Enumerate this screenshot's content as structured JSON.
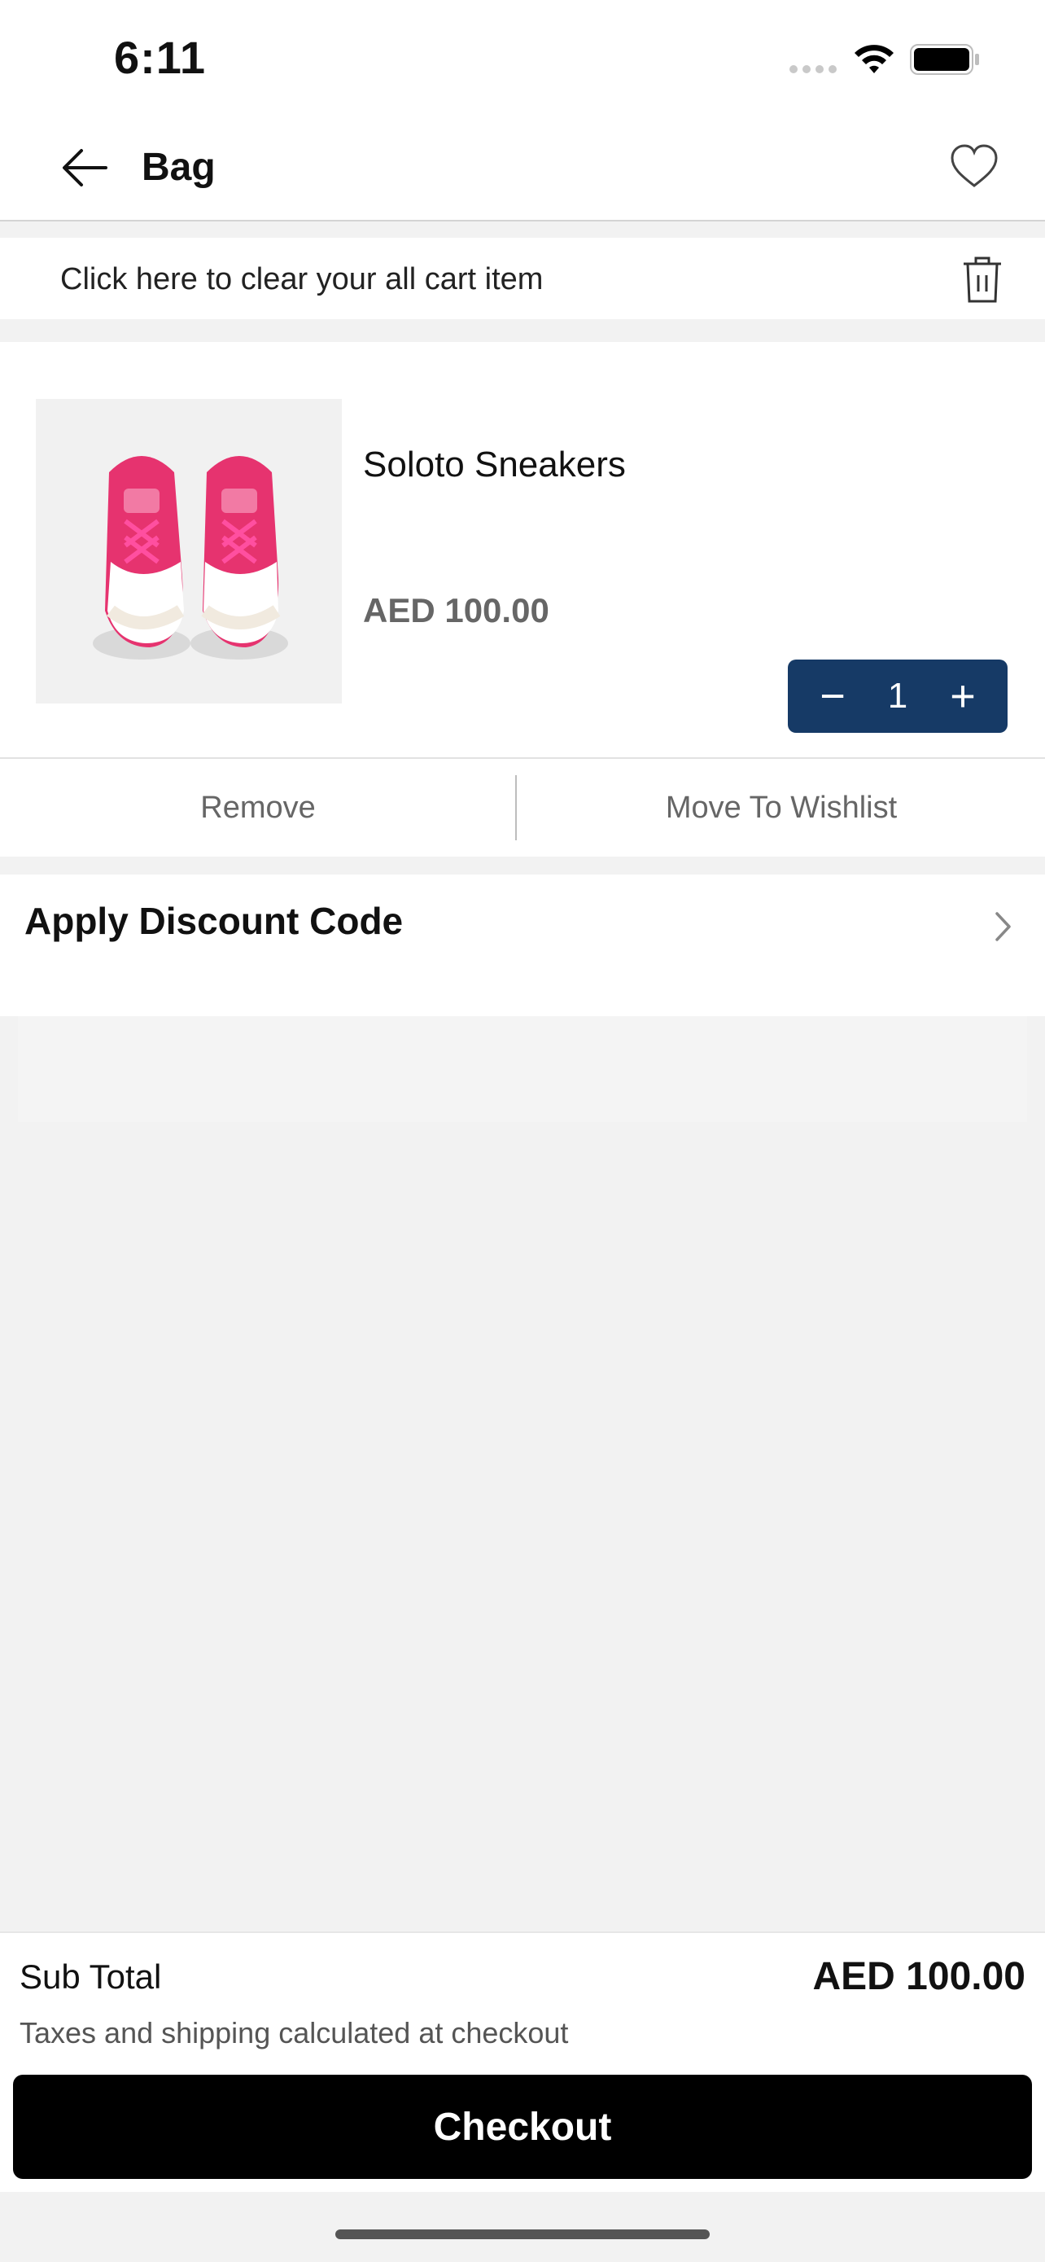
{
  "status": {
    "time": "6:11"
  },
  "header": {
    "title": "Bag"
  },
  "clear_cart": {
    "text": "Click here to clear your all cart item"
  },
  "cart_item": {
    "name": "Soloto Sneakers",
    "price": "AED 100.00",
    "quantity": "1",
    "minus": "−",
    "plus": "+",
    "remove_label": "Remove",
    "wishlist_label": "Move To Wishlist"
  },
  "discount": {
    "label": "Apply Discount Code"
  },
  "summary": {
    "subtotal_label": "Sub Total",
    "subtotal_value": "AED 100.00",
    "tax_note": "Taxes and shipping calculated at checkout",
    "checkout_label": "Checkout"
  },
  "colors": {
    "accent": "#163a66",
    "checkout": "#000000",
    "product_pink": "#e6336f"
  },
  "icons": [
    "back-arrow-icon",
    "heart-icon",
    "trash-icon",
    "chevron-right-icon",
    "wifi-icon",
    "battery-icon",
    "signal-icon"
  ]
}
